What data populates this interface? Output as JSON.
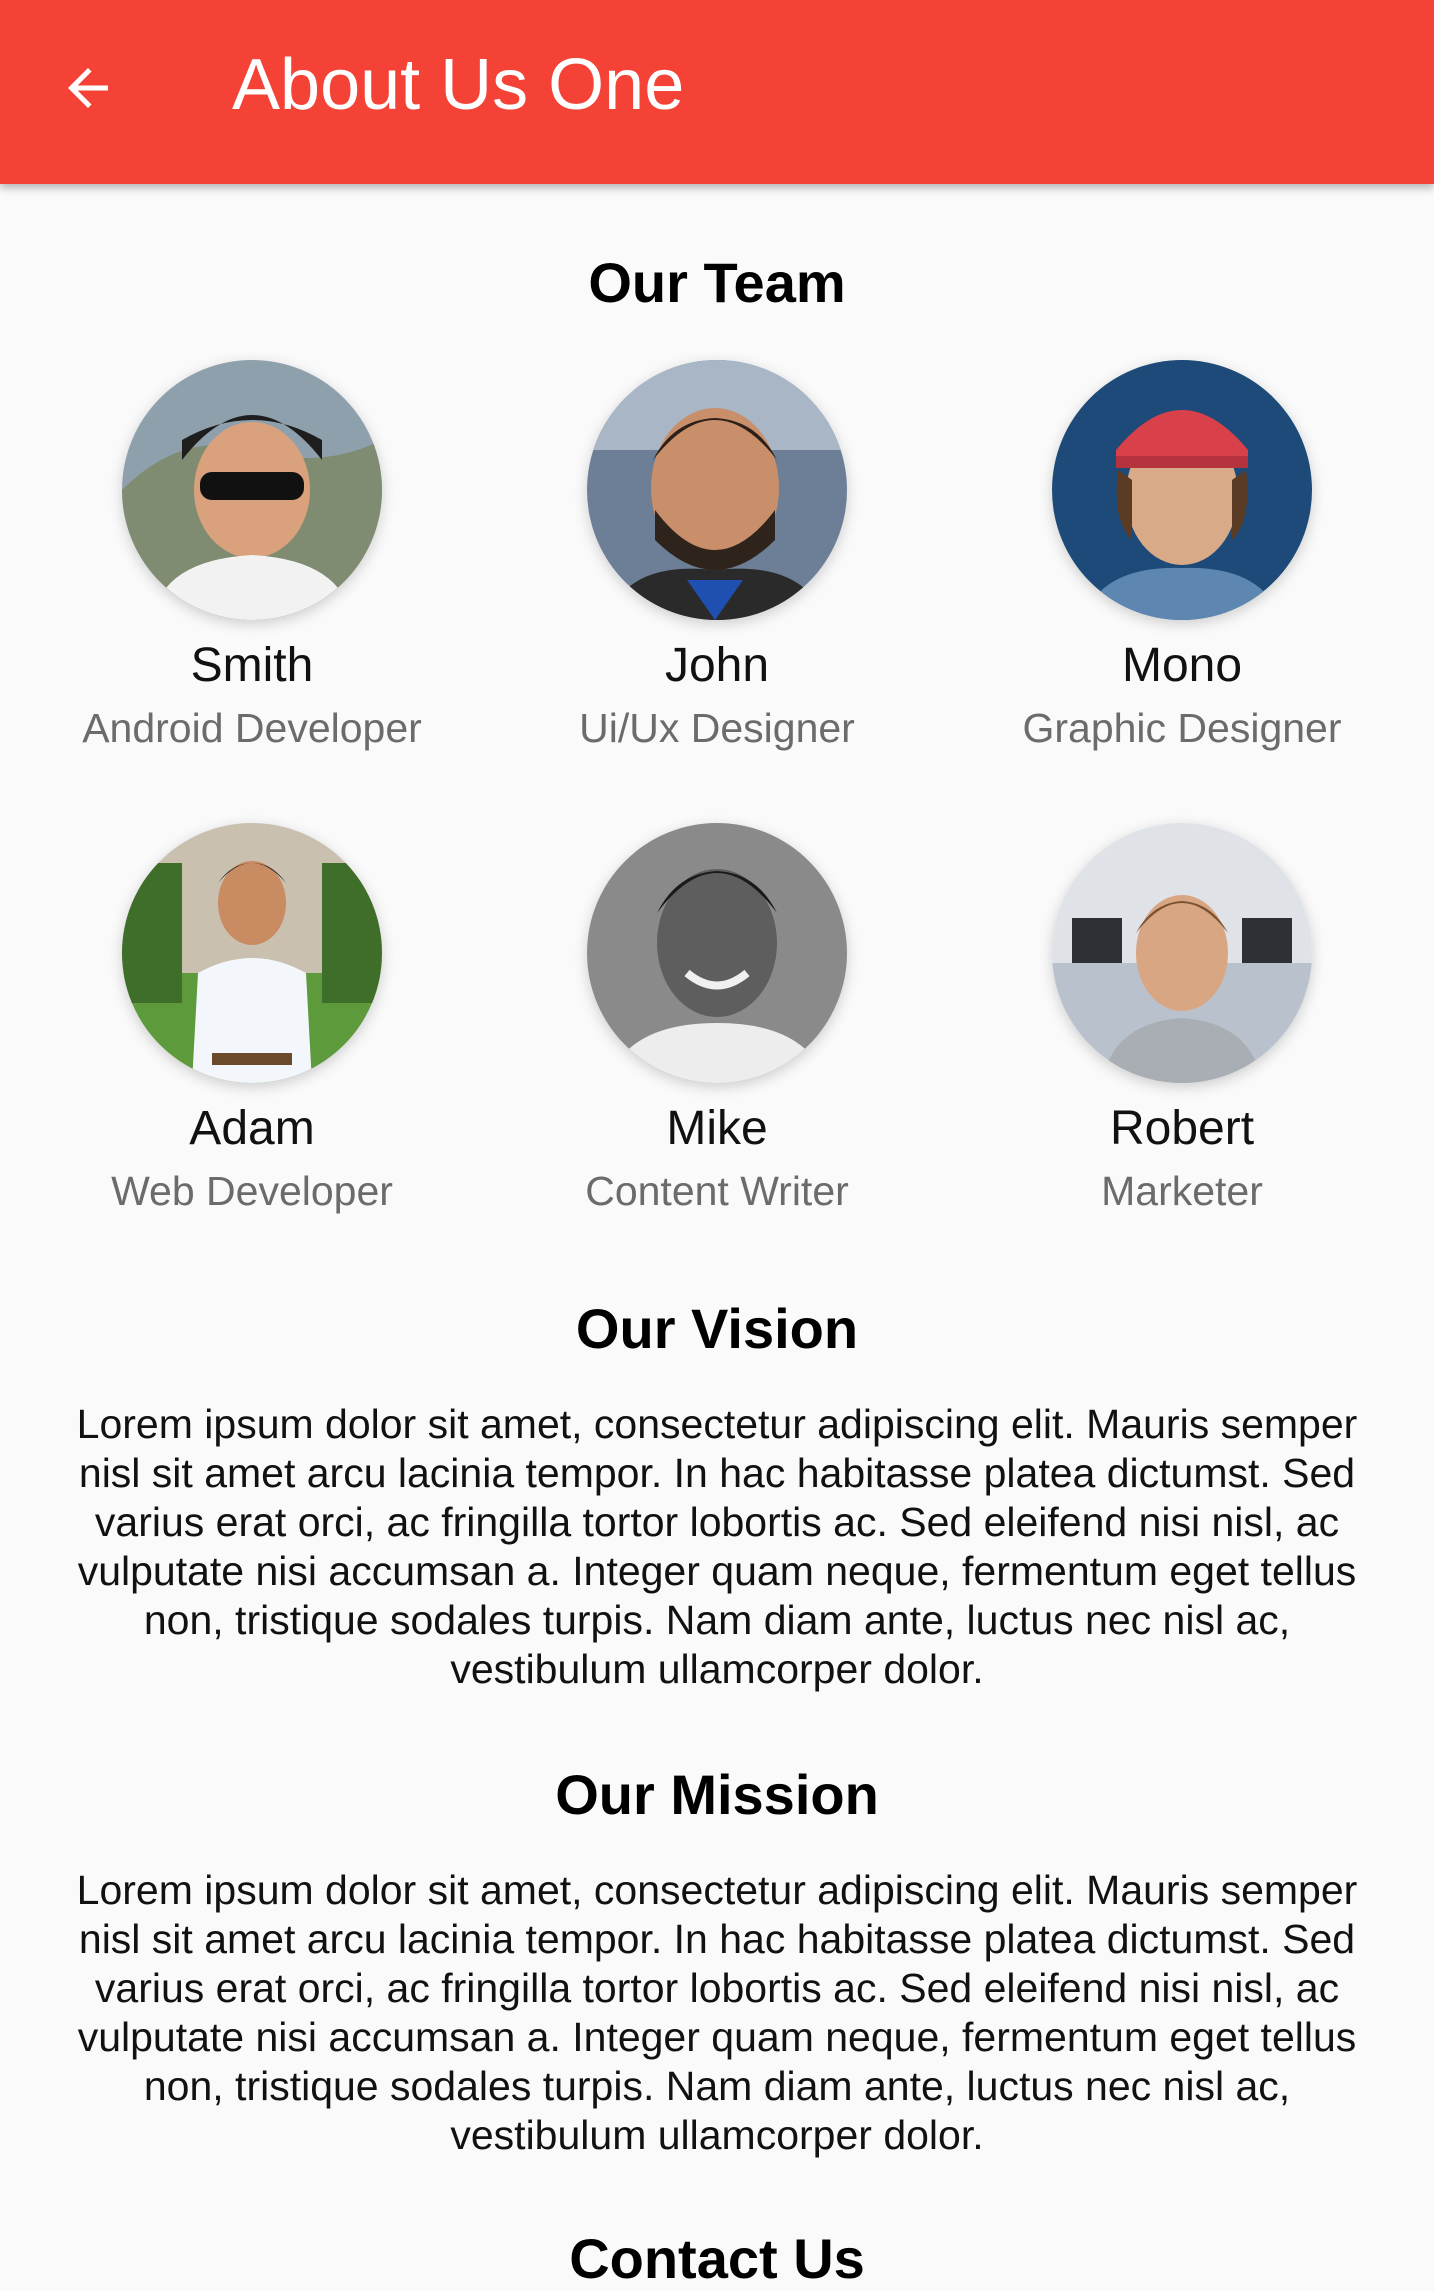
{
  "app_bar": {
    "title": "About Us One",
    "background_color": "#f44336",
    "back_icon": "arrow-back-icon"
  },
  "team": {
    "heading": "Our Team",
    "members": [
      {
        "name": "Smith",
        "role": "Android Developer",
        "avatar": "avatar-photo"
      },
      {
        "name": "John",
        "role": "Ui/Ux Designer",
        "avatar": "avatar-photo"
      },
      {
        "name": "Mono",
        "role": "Graphic Designer",
        "avatar": "avatar-photo"
      },
      {
        "name": "Adam",
        "role": "Web Developer",
        "avatar": "avatar-photo"
      },
      {
        "name": "Mike",
        "role": "Content Writer",
        "avatar": "avatar-photo"
      },
      {
        "name": "Robert",
        "role": "Marketer",
        "avatar": "avatar-photo"
      }
    ]
  },
  "vision": {
    "heading": "Our Vision",
    "text": "Lorem ipsum dolor sit amet, consectetur adipiscing elit. Mauris semper nisl sit amet arcu lacinia tempor. In hac habitasse platea dictumst. Sed varius erat orci, ac fringilla tortor lobortis ac. Sed eleifend nisi nisl, ac vulputate nisi accumsan a. Integer quam neque, fermentum eget tellus non, tristique sodales turpis. Nam diam ante, luctus nec nisl ac, vestibulum ullamcorper dolor."
  },
  "mission": {
    "heading": "Our Mission",
    "text": "Lorem ipsum dolor sit amet, consectetur adipiscing elit. Mauris semper nisl sit amet arcu lacinia tempor. In hac habitasse platea dictumst. Sed varius erat orci, ac fringilla tortor lobortis ac. Sed eleifend nisi nisl, ac vulputate nisi accumsan a. Integer quam neque, fermentum eget tellus non, tristique sodales turpis. Nam diam ante, luctus nec nisl ac, vestibulum ullamcorper dolor."
  },
  "contact": {
    "heading": "Contact Us"
  }
}
